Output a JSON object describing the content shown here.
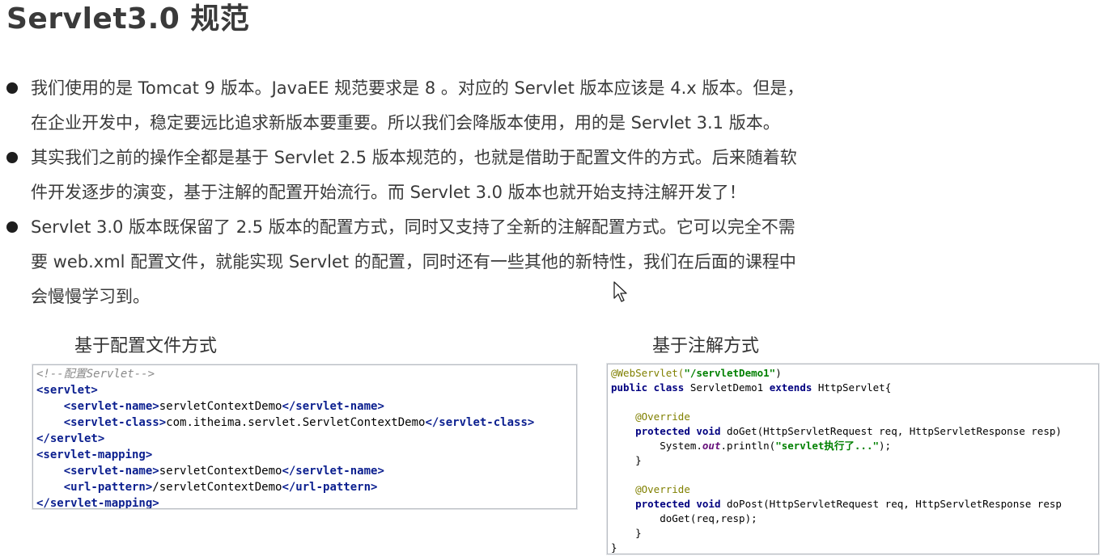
{
  "page": {
    "title": "Servlet3.0 规范"
  },
  "bullets": [
    {
      "lines": [
        "我们使用的是 Tomcat 9 版本。JavaEE 规范要求是 8 。对应的 Servlet 版本应该是 4.x 版本。但是，",
        "在企业开发中，稳定要远比追求新版本要重要。所以我们会降版本使用，用的是 Servlet 3.1 版本。"
      ]
    },
    {
      "lines": [
        "其实我们之前的操作全都是基于 Servlet 2.5 版本规范的，也就是借助于配置文件的方式。后来随着软",
        "件开发逐步的演变，基于注解的配置开始流行。而 Servlet 3.0 版本也就开始支持注解开发了！"
      ]
    },
    {
      "lines": [
        "Servlet 3.0 版本既保留了 2.5 版本的配置方式，同时又支持了全新的注解配置方式。它可以完全不需",
        "要 web.xml 配置文件，就能实现 Servlet 的配置，同时还有一些其他的新特性，我们在后面的课程中",
        "会慢慢学习到。"
      ]
    }
  ],
  "captions": {
    "config_file": "基于配置文件方式",
    "annotation": "基于注解方式"
  },
  "xml_code": [
    [
      {
        "t": "<!--配置Servlet-->",
        "c": "comment"
      }
    ],
    [
      {
        "t": "<servlet>",
        "c": "tag"
      }
    ],
    [
      {
        "t": "    ",
        "c": "text"
      },
      {
        "t": "<servlet-name>",
        "c": "tag"
      },
      {
        "t": "servletContextDemo",
        "c": "text"
      },
      {
        "t": "</servlet-name>",
        "c": "tag"
      }
    ],
    [
      {
        "t": "    ",
        "c": "text"
      },
      {
        "t": "<servlet-class>",
        "c": "tag"
      },
      {
        "t": "com.itheima.servlet.ServletContextDemo",
        "c": "text"
      },
      {
        "t": "</servlet-class>",
        "c": "tag"
      }
    ],
    [
      {
        "t": "</servlet>",
        "c": "tag"
      }
    ],
    [
      {
        "t": "<servlet-mapping>",
        "c": "tag"
      }
    ],
    [
      {
        "t": "    ",
        "c": "text"
      },
      {
        "t": "<servlet-name>",
        "c": "tag"
      },
      {
        "t": "servletContextDemo",
        "c": "text"
      },
      {
        "t": "</servlet-name>",
        "c": "tag"
      }
    ],
    [
      {
        "t": "    ",
        "c": "text"
      },
      {
        "t": "<url-pattern>",
        "c": "tag"
      },
      {
        "t": "/servletContextDemo",
        "c": "text"
      },
      {
        "t": "</url-pattern>",
        "c": "tag"
      }
    ],
    [
      {
        "t": "</servlet-mapping>",
        "c": "tag"
      }
    ]
  ],
  "java_code": [
    [
      {
        "t": "@WebServlet(",
        "c": "ann"
      },
      {
        "t": "\"/servletDemo1\"",
        "c": "str"
      },
      {
        "t": ")",
        "c": "text"
      }
    ],
    [
      {
        "t": "public class ",
        "c": "kw"
      },
      {
        "t": "ServletDemo1 ",
        "c": "text"
      },
      {
        "t": "extends ",
        "c": "kw"
      },
      {
        "t": "HttpServlet{",
        "c": "text"
      }
    ],
    [
      {
        "t": "",
        "c": "text"
      }
    ],
    [
      {
        "t": "    ",
        "c": "text"
      },
      {
        "t": "@Override",
        "c": "ann"
      }
    ],
    [
      {
        "t": "    ",
        "c": "text"
      },
      {
        "t": "protected void ",
        "c": "kw"
      },
      {
        "t": "doGet(HttpServletRequest req, HttpServletResponse resp)",
        "c": "text"
      }
    ],
    [
      {
        "t": "        System.",
        "c": "text"
      },
      {
        "t": "out",
        "c": "field"
      },
      {
        "t": ".println(",
        "c": "text"
      },
      {
        "t": "\"servlet执行了...\"",
        "c": "str"
      },
      {
        "t": ");",
        "c": "text"
      }
    ],
    [
      {
        "t": "    }",
        "c": "text"
      }
    ],
    [
      {
        "t": "",
        "c": "text"
      }
    ],
    [
      {
        "t": "    ",
        "c": "text"
      },
      {
        "t": "@Override",
        "c": "ann"
      }
    ],
    [
      {
        "t": "    ",
        "c": "text"
      },
      {
        "t": "protected void ",
        "c": "kw"
      },
      {
        "t": "doPost(HttpServletRequest req, HttpServletResponse resp",
        "c": "text"
      }
    ],
    [
      {
        "t": "        doGet(req,resp);",
        "c": "text"
      }
    ],
    [
      {
        "t": "    }",
        "c": "text"
      }
    ],
    [
      {
        "t": "}",
        "c": "text"
      }
    ]
  ]
}
